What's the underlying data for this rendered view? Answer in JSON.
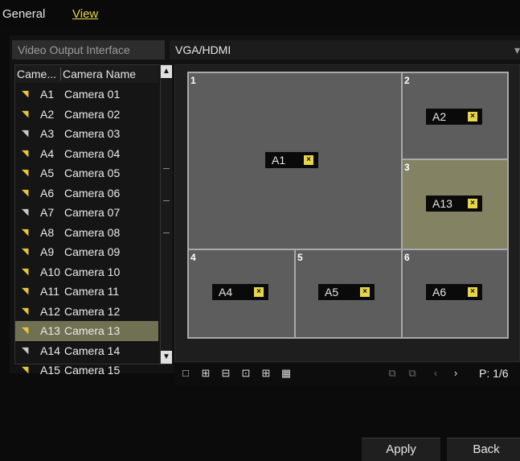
{
  "tabs": {
    "general": "General",
    "view": "View"
  },
  "video_output": {
    "label": "Video Output Interface",
    "value": "VGA/HDMI"
  },
  "camera_list": {
    "header_col1": "Came...",
    "header_col2": "Camera Name",
    "rows": [
      {
        "no": "A1",
        "name": "Camera 01",
        "active": true
      },
      {
        "no": "A2",
        "name": "Camera 02",
        "active": true
      },
      {
        "no": "A3",
        "name": "Camera 03",
        "active": false
      },
      {
        "no": "A4",
        "name": "Camera 04",
        "active": true
      },
      {
        "no": "A5",
        "name": "Camera 05",
        "active": true
      },
      {
        "no": "A6",
        "name": "Camera 06",
        "active": true
      },
      {
        "no": "A7",
        "name": "Camera 07",
        "active": false
      },
      {
        "no": "A8",
        "name": "Camera 08",
        "active": true
      },
      {
        "no": "A9",
        "name": "Camera 09",
        "active": true
      },
      {
        "no": "A10",
        "name": "Camera 10",
        "active": true
      },
      {
        "no": "A11",
        "name": "Camera 11",
        "active": true
      },
      {
        "no": "A12",
        "name": "Camera 12",
        "active": true
      },
      {
        "no": "A13",
        "name": "Camera 13",
        "active": true,
        "selected": true
      },
      {
        "no": "A14",
        "name": "Camera 14",
        "active": false
      },
      {
        "no": "A15",
        "name": "Camera 15",
        "active": true
      }
    ]
  },
  "layout_cells": [
    {
      "index": "1",
      "camera": "A1"
    },
    {
      "index": "2",
      "camera": "A2"
    },
    {
      "index": "3",
      "camera": "A13",
      "highlighted": true
    },
    {
      "index": "4",
      "camera": "A4"
    },
    {
      "index": "5",
      "camera": "A5"
    },
    {
      "index": "6",
      "camera": "A6"
    }
  ],
  "toolbar": {
    "page": "P: 1/6"
  },
  "buttons": {
    "apply": "Apply",
    "back": "Back"
  },
  "colors": {
    "accent": "#e8d64a",
    "selected_row": "#707052",
    "highlight_cell": "#838363"
  },
  "icons": [
    "camera-icon",
    "close-icon",
    "layout-1-icon",
    "layout-4-icon",
    "layout-6-icon",
    "layout-8-icon",
    "layout-9-icon",
    "layout-16-icon",
    "prev-icon",
    "next-icon"
  ]
}
